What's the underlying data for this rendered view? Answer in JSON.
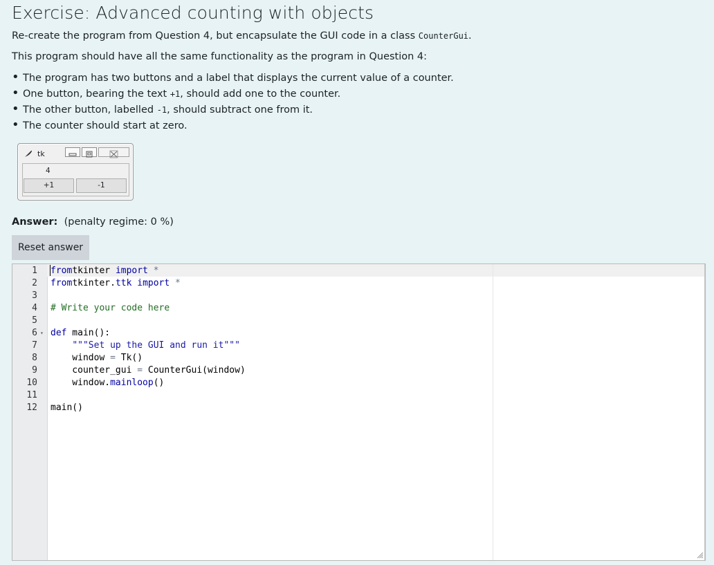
{
  "header": {
    "title": "Exercise: Advanced counting with objects"
  },
  "intro": {
    "line1_prefix": "Re-create the program from Question 4, but encapsulate the GUI code in a class ",
    "line1_code": "CounterGui",
    "line1_suffix": ".",
    "line2": "This program should have all the same functionality as the program in Question 4:"
  },
  "bullets": [
    {
      "text": "The program has two buttons and a label that displays the current value of a counter."
    },
    {
      "prefix": "One button, bearing the text ",
      "code": "+1",
      "suffix": ", should add one to the counter."
    },
    {
      "prefix": "The other button, labelled ",
      "code": "-1",
      "suffix": ", should subtract one from it."
    },
    {
      "text": "The counter should start at zero."
    }
  ],
  "tk_window": {
    "title": "tk",
    "counter_value": "4",
    "plus_label": "+1",
    "minus_label": "-1",
    "icons": [
      "feather-icon",
      "minimize-icon",
      "maximize-icon",
      "close-icon"
    ]
  },
  "answer": {
    "label": "Answer:",
    "penalty": "(penalty regime: 0 %)",
    "reset_label": "Reset answer"
  },
  "editor": {
    "lines": [
      {
        "n": "1",
        "tokens": [
          [
            "kw",
            "from"
          ],
          [
            "",
            "tkinter "
          ],
          [
            "kw",
            "import"
          ],
          [
            "op",
            " *"
          ]
        ]
      },
      {
        "n": "2",
        "tokens": [
          [
            "kw",
            "from"
          ],
          [
            "",
            "tkinter."
          ],
          [
            "kw",
            "ttk"
          ],
          [
            "",
            ""
          ],
          [
            "kw",
            " import"
          ],
          [
            "op",
            " *"
          ]
        ]
      },
      {
        "n": "3",
        "tokens": []
      },
      {
        "n": "4",
        "tokens": [
          [
            "cm",
            "# Write your code here"
          ]
        ]
      },
      {
        "n": "5",
        "tokens": []
      },
      {
        "n": "6",
        "fold": true,
        "tokens": [
          [
            "kw",
            "def"
          ],
          [
            "",
            " main():"
          ]
        ]
      },
      {
        "n": "7",
        "tokens": [
          [
            "",
            "    "
          ],
          [
            "st",
            "\"\"\"Set up the GUI and run it\"\"\""
          ]
        ]
      },
      {
        "n": "8",
        "tokens": [
          [
            "",
            "    window "
          ],
          [
            "op",
            "="
          ],
          [
            "",
            " Tk()"
          ]
        ]
      },
      {
        "n": "9",
        "tokens": [
          [
            "",
            "    counter_gui "
          ],
          [
            "op",
            "="
          ],
          [
            "",
            " CounterGui(window)"
          ]
        ]
      },
      {
        "n": "10",
        "tokens": [
          [
            "",
            "    window."
          ],
          [
            "kw",
            "mainloop"
          ],
          [
            "",
            "()"
          ]
        ]
      },
      {
        "n": "11",
        "tokens": []
      },
      {
        "n": "12",
        "tokens": [
          [
            "",
            "main()"
          ]
        ]
      }
    ]
  }
}
